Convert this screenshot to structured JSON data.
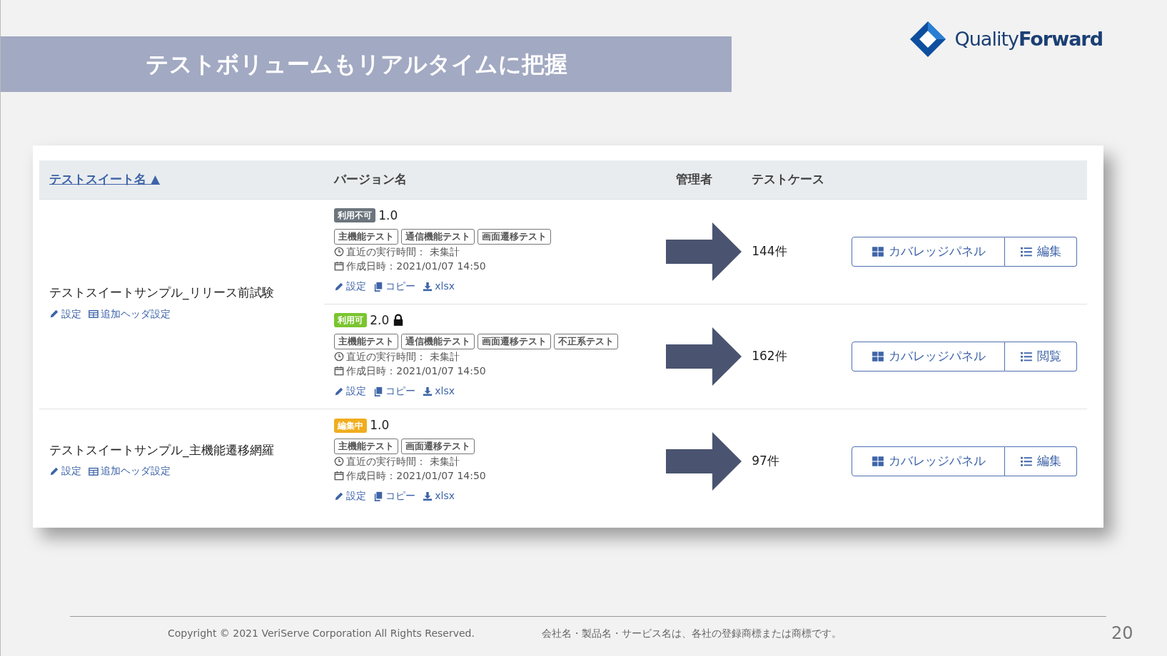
{
  "slide": {
    "title": "テストボリュームもリアルタイムに把握",
    "logo": {
      "light": "Quality",
      "bold": "Forward"
    },
    "copyright": "Copyright © 2021 VeriServe Corporation All Rights Reserved.",
    "trademark": "会社名・製品名・サービス名は、各社の登録商標または商標です。",
    "page_number": "20"
  },
  "table": {
    "columns": [
      {
        "label": "テストスイート名",
        "sort_mark": "▲"
      },
      {
        "label": "バージョン名"
      },
      {
        "label": "管理者"
      },
      {
        "label": "テストケース"
      }
    ],
    "suites": [
      {
        "name": "テストスイートサンプル_リリース前試験",
        "actions": [
          {
            "label": "設定",
            "kind": "pencil"
          },
          {
            "label": "追加ヘッダ設定",
            "kind": "table"
          }
        ],
        "versions": [
          {
            "status": {
              "label": "利用不可",
              "kind": "unavailable"
            },
            "version": "1.0",
            "locked": false,
            "tags": [
              "主機能テスト",
              "通信機能テスト",
              "画面遷移テスト"
            ],
            "last_run": "直近の実行時間： 未集計",
            "created": "作成日時：2021/01/07 14:50",
            "actions": [
              {
                "label": "設定",
                "kind": "pencil"
              },
              {
                "label": "コピー",
                "kind": "copy"
              },
              {
                "label": "xlsx",
                "kind": "download"
              }
            ],
            "test_cases": "144件",
            "buttons": [
              {
                "label": "カバレッジパネル",
                "kind": "grid"
              },
              {
                "label": "編集",
                "kind": "list"
              }
            ]
          },
          {
            "status": {
              "label": "利用可",
              "kind": "available"
            },
            "version": "2.0",
            "locked": true,
            "tags": [
              "主機能テスト",
              "通信機能テスト",
              "画面遷移テスト",
              "不正系テスト"
            ],
            "last_run": "直近の実行時間： 未集計",
            "created": "作成日時：2021/01/07 14:50",
            "actions": [
              {
                "label": "設定",
                "kind": "pencil"
              },
              {
                "label": "コピー",
                "kind": "copy"
              },
              {
                "label": "xlsx",
                "kind": "download"
              }
            ],
            "test_cases": "162件",
            "buttons": [
              {
                "label": "カバレッジパネル",
                "kind": "grid"
              },
              {
                "label": "閲覧",
                "kind": "list"
              }
            ]
          }
        ]
      },
      {
        "name": "テストスイートサンプル_主機能遷移網羅",
        "actions": [
          {
            "label": "設定",
            "kind": "pencil"
          },
          {
            "label": "追加ヘッダ設定",
            "kind": "table"
          }
        ],
        "versions": [
          {
            "status": {
              "label": "編集中",
              "kind": "editing"
            },
            "version": "1.0",
            "locked": false,
            "tags": [
              "主機能テスト",
              "画面遷移テスト"
            ],
            "last_run": "直近の実行時間： 未集計",
            "created": "作成日時：2021/01/07 14:50",
            "actions": [
              {
                "label": "設定",
                "kind": "pencil"
              },
              {
                "label": "コピー",
                "kind": "copy"
              },
              {
                "label": "xlsx",
                "kind": "download"
              }
            ],
            "test_cases": "97件",
            "buttons": [
              {
                "label": "カバレッジパネル",
                "kind": "grid"
              },
              {
                "label": "編集",
                "kind": "list"
              }
            ]
          }
        ]
      }
    ]
  }
}
